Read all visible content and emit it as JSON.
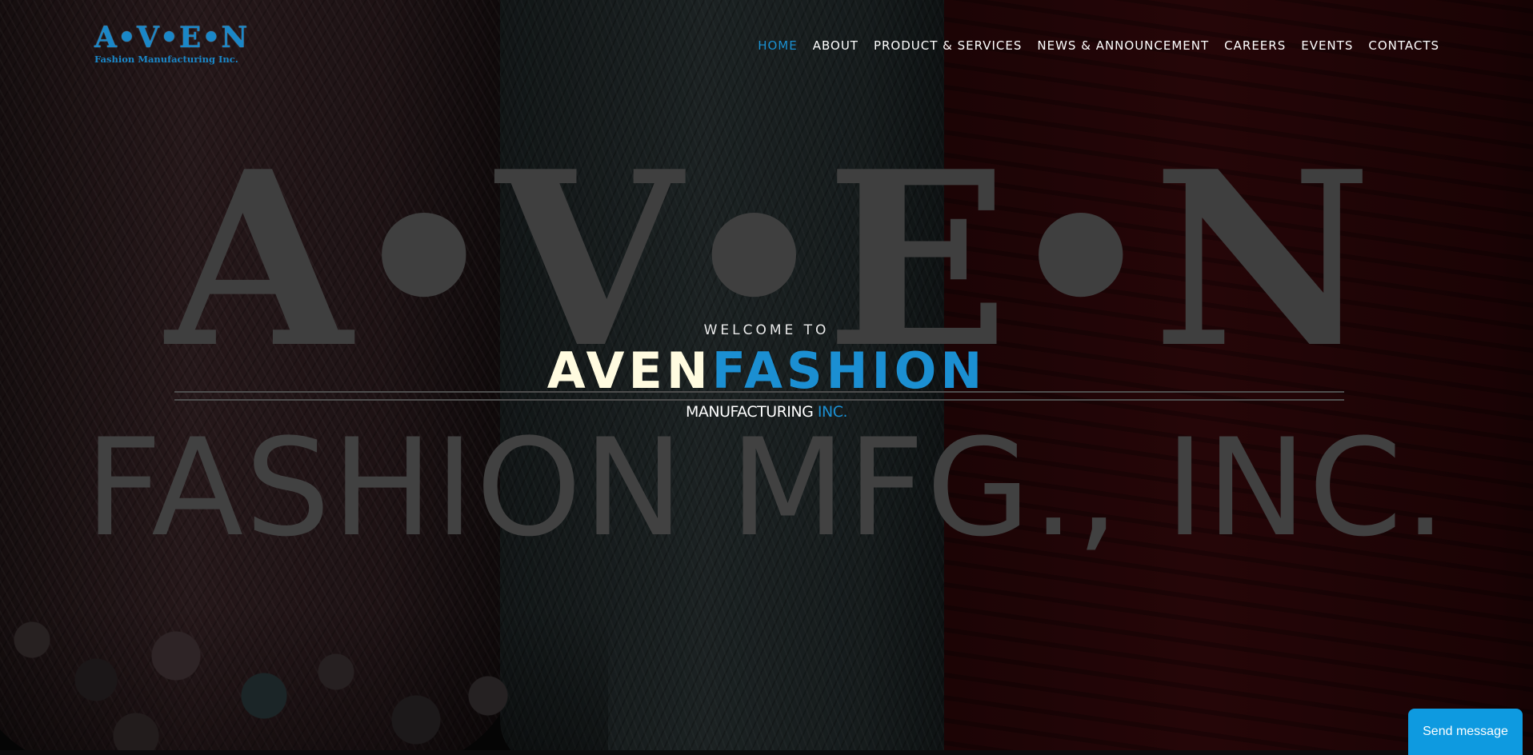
{
  "brand": {
    "logo_mark": "A•V•E•N",
    "logo_sub": "Fashion Manufacturing Inc."
  },
  "nav": {
    "items": [
      {
        "label": "HOME",
        "active": true
      },
      {
        "label": "ABOUT",
        "active": false
      },
      {
        "label": "PRODUCT & SERVICES",
        "active": false
      },
      {
        "label": "NEWS & ANNOUNCEMENT",
        "active": false
      },
      {
        "label": "CAREERS",
        "active": false
      },
      {
        "label": "EVENTS",
        "active": false
      },
      {
        "label": "CONTACTS",
        "active": false
      }
    ]
  },
  "hero": {
    "watermark_top": "A•V•E•N",
    "watermark_bottom": "FASHION MFG., INC.",
    "welcome": "WELCOME TO",
    "headline_part1": "AVEN",
    "headline_part2": "FASHION",
    "sub_part1": "MANUFACTURING",
    "sub_part2": "INC."
  },
  "chat": {
    "button_label": "Send message"
  },
  "colors": {
    "accent": "#1b8fd2",
    "headline_light": "#fffbe0",
    "chat_button": "#0e9ae0"
  }
}
